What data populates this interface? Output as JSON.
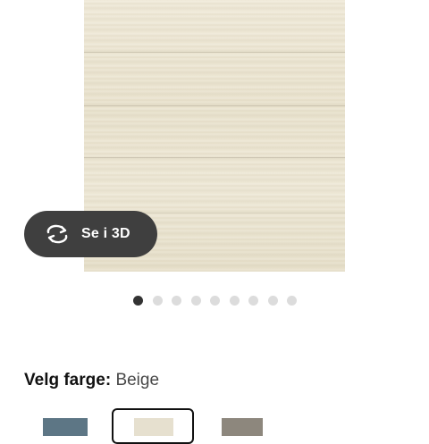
{
  "gallery": {
    "button_3d_label": "Se i 3D",
    "icon_3d": "rotate-3d-icon",
    "dots_count": 9,
    "active_dot": 0
  },
  "color_picker": {
    "label": "Velg farge:",
    "selected_value": "Beige",
    "swatches": [
      {
        "name": "blue-grey",
        "color": "#5d7685",
        "selected": false
      },
      {
        "name": "beige",
        "color": "#e6e0cf",
        "selected": true
      },
      {
        "name": "grey-brown",
        "color": "#8d877d",
        "selected": false
      }
    ]
  },
  "colors": {
    "button_bg": "#3f3f3f",
    "dot_active": "#333333",
    "dot_inactive": "#dcdcdc"
  }
}
